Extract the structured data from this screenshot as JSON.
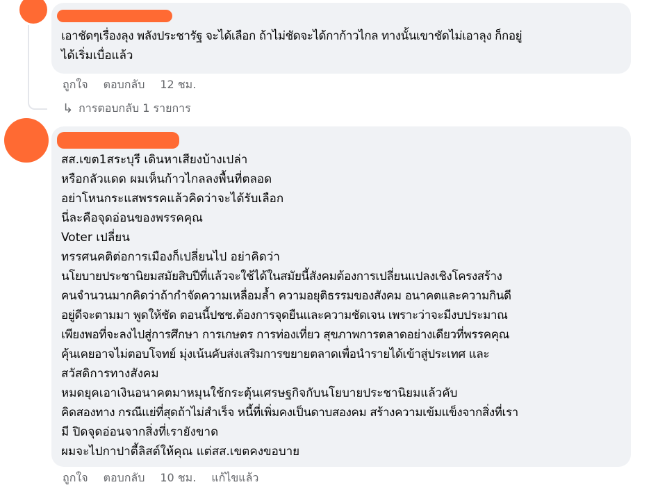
{
  "colors": {
    "bubble": "#f0f2f5",
    "redaction": "#ff6a33",
    "meta_text": "#65676b"
  },
  "comment1": {
    "lines": [
      "เอาชัดๆเรื่องลุง พลังประชารัฐ จะได้เลือก ถ้าไม่ชัดจะได้กาก้าวไกล ทางนั้นเขาชัดไม่เอาลุง ก็กอยู่",
      "ได้เริ่มเบื่อแล้ว"
    ],
    "actions": {
      "like": "ถูกใจ",
      "reply": "ตอบกลับ",
      "time": "12 ชม."
    },
    "replies_link": "การตอบกลับ 1 รายการ"
  },
  "comment2": {
    "lines": [
      "สส.เขต1สระบุรี เดินหาเสียงบ้างเปล่า",
      "หรือกลัวแดด ผมเห็นก้าวไกลลงพื้นที่ตลอด",
      "อย่าโหนกระแสพรรคแล้วคิดว่าจะได้รับเลือก",
      "นี่ละคือจุดอ่อนของพรรคคุณ",
      "Voter เปลี่ยน",
      "ทรรศนคติต่อการเมืองก็เปลี่ยนไป อย่าคิดว่า",
      "นโยบายประชานิยมสมัยสิบปีที่แล้วจะใช้ได้ในสมัยนี้สังคมต้องการเปลี่ยนแปลงเชิงโครงสร้าง",
      "คนจำนวนมากคิดว่าถ้ากำจัดความเหลื่อมล้ำ ความอยุติธรรมของสังคม อนาคตและความกินดี",
      "อยู่ดีจะตามมา พูดให้ชัด ตอนนี้ปชช.ต้องการจุดยืนและความชัดเจน เพราะว่าจะมีงบประมาณ",
      "เพียงพอที่จะลงไปสู่การศึกษา การเกษตร การท่องเที่ยว สุขภาพการตลาดอย่างเดียวที่พรรคคุณ",
      "คุ้นเคยอาจไม่ตอบโจทย์ มุ่งเน้นคับส่งเสริมการขยายตลาดเพื่อนำรายได้เข้าสู่ประเทศ และ",
      "สวัสดิการทางสังคม",
      "หมดยุคเอาเงินอนาคตมาหมุนใช้กระตุ้นเศรษฐกิจกับนโยบายประชานิยมแล้วคับ",
      "คิดสองทาง กรณีแย่ที่สุดถ้าไม่สำเร็จ หนี้ที่เพิ่มคงเป็นดาบสองคม สร้างความเข้มแข็งจากสิ่งที่เรา",
      "มี ปิดจุดอ่อนจากสิ่งที่เรายังขาด",
      "ผมจะไปกาปาตี้ลิสต์ให้คุณ แต่สส.เขตคงขอบาย"
    ],
    "actions": {
      "like": "ถูกใจ",
      "reply": "ตอบกลับ",
      "time": "10 ชม.",
      "edited": "แก้ไขแล้ว"
    }
  }
}
